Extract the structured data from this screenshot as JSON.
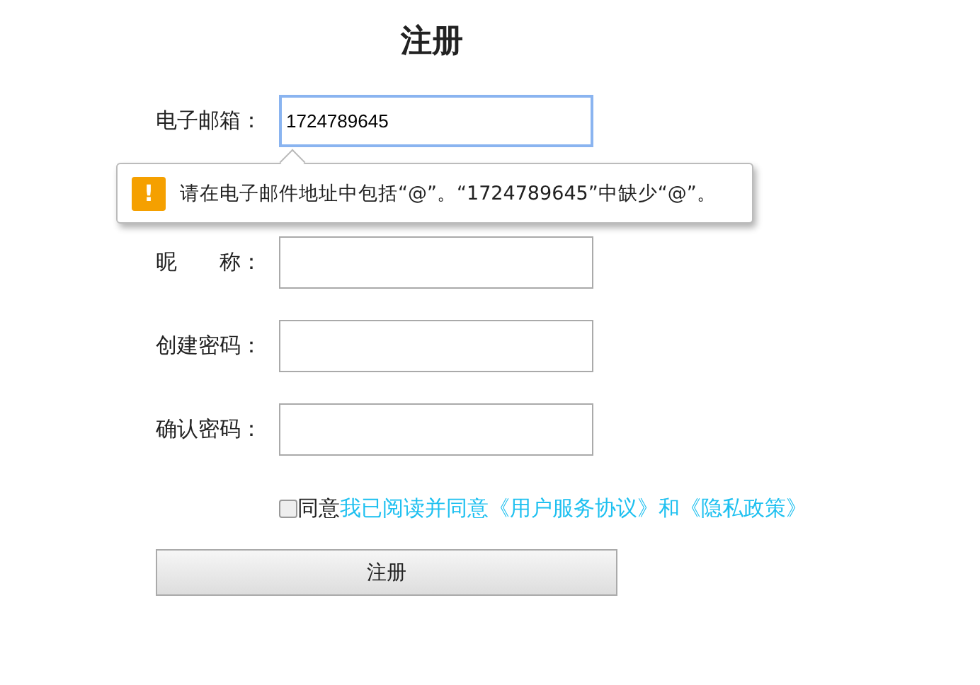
{
  "title": "注册",
  "fields": [
    {
      "label": "电子邮箱：",
      "value": "1724789645",
      "focused": true
    },
    {
      "label": "昵　　称：",
      "focused": false
    },
    {
      "label": "创建密码：",
      "focused": false
    },
    {
      "label": "确认密码：",
      "focused": false
    }
  ],
  "tooltip": {
    "icon": "!",
    "message": "请在电子邮件地址中包括“@”。“1724789645”中缺少“@”。"
  },
  "agreement": {
    "checked": false,
    "text": "同意",
    "link": "我已阅读并同意《用户服务协议》和《隐私政策》"
  },
  "submit": "注册"
}
